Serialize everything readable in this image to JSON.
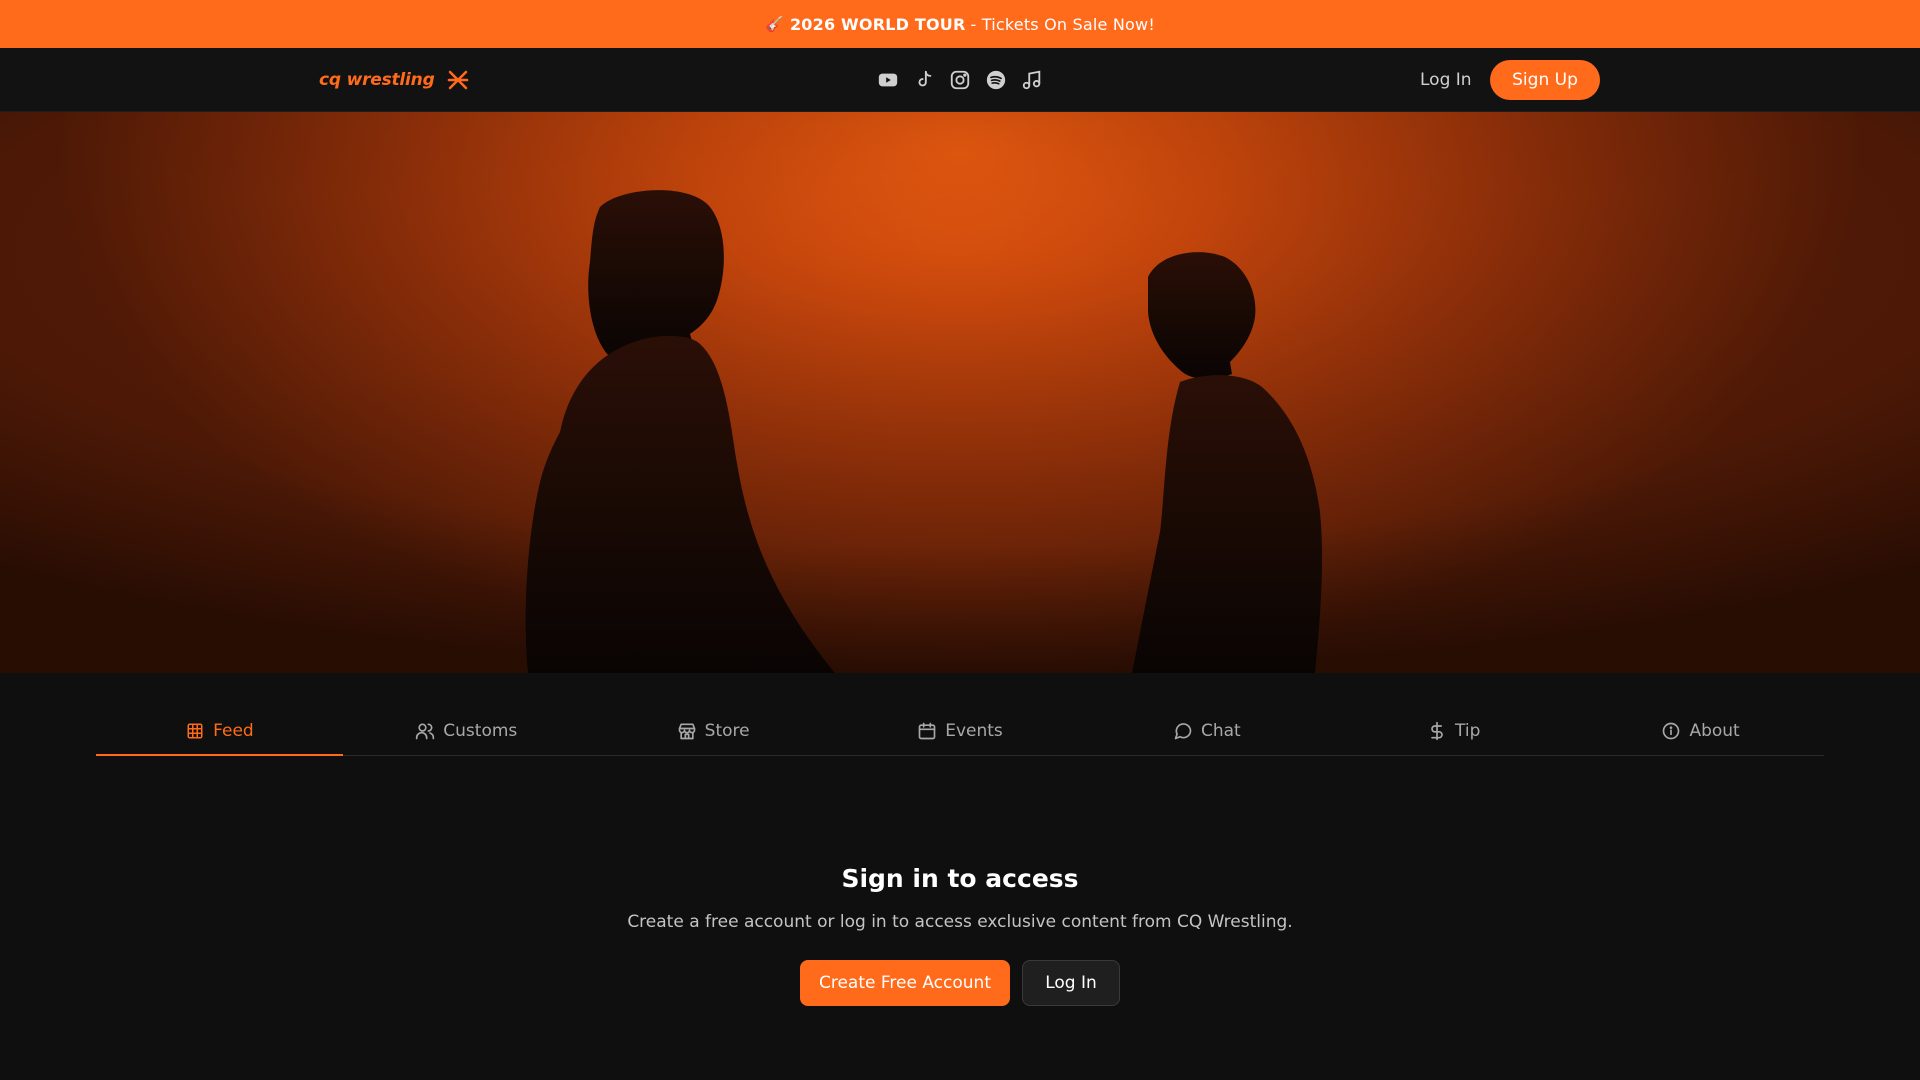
{
  "promo": {
    "emoji": "🎸",
    "bold": "2026 WORLD TOUR",
    "rest": "- Tickets On Sale Now!"
  },
  "header": {
    "logo_text": "cq wrestling",
    "logo_icon": "asterisk-mark-icon",
    "socials": [
      "youtube-icon",
      "tiktok-icon",
      "instagram-icon",
      "spotify-icon",
      "music-note-icon"
    ],
    "login_label": "Log In",
    "signup_label": "Sign Up"
  },
  "hero": {
    "image": "two-figures-orange-backdrop"
  },
  "tabs": [
    {
      "label": "Feed",
      "icon": "grid-icon",
      "active": true
    },
    {
      "label": "Customs",
      "icon": "users-icon",
      "active": false
    },
    {
      "label": "Store",
      "icon": "store-icon",
      "active": false
    },
    {
      "label": "Events",
      "icon": "calendar-icon",
      "active": false
    },
    {
      "label": "Chat",
      "icon": "chat-bubble-icon",
      "active": false
    },
    {
      "label": "Tip",
      "icon": "dollar-icon",
      "active": false
    },
    {
      "label": "About",
      "icon": "info-icon",
      "active": false
    }
  ],
  "signin": {
    "title": "Sign in to access",
    "description": "Create a free account or log in to access exclusive content from CQ Wrestling.",
    "create_label": "Create Free Account",
    "login_label": "Log In"
  },
  "colors": {
    "accent": "#ff6b1a",
    "background": "#0f0f0f",
    "header": "#121212"
  }
}
